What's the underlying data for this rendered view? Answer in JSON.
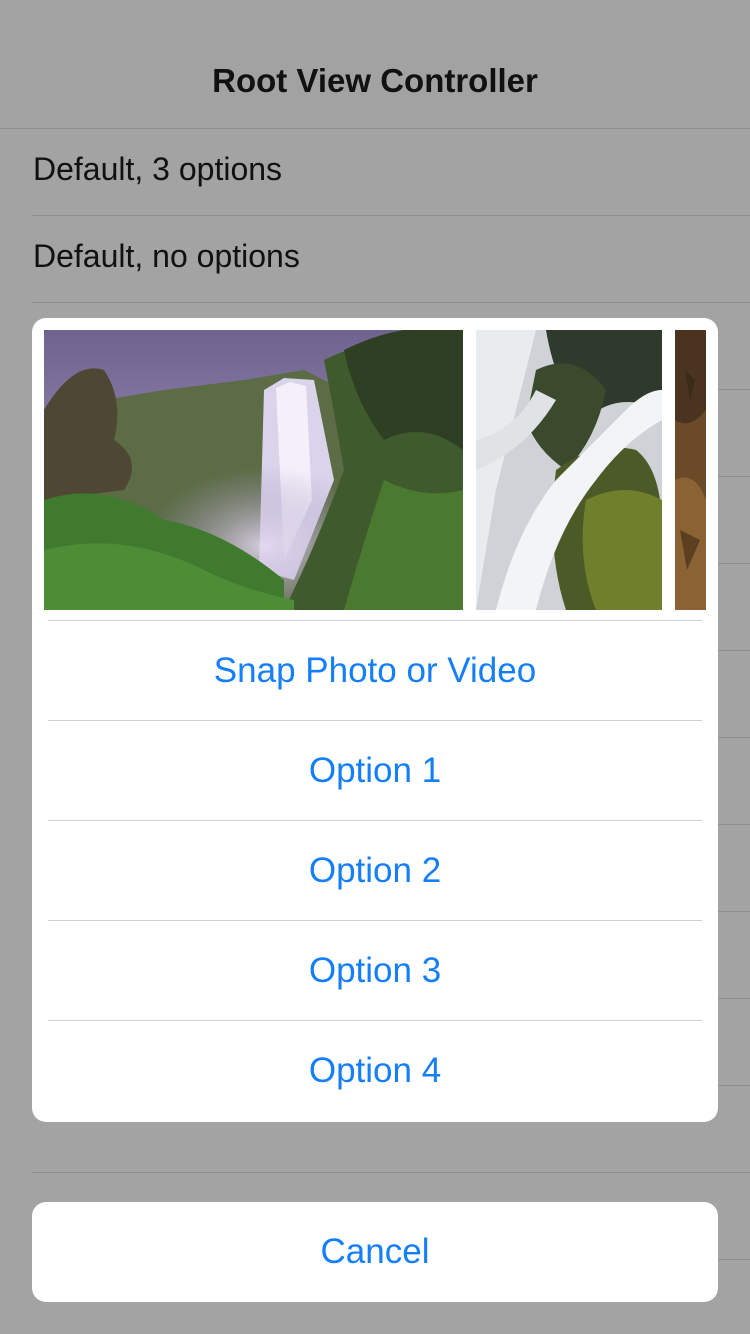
{
  "navbar": {
    "title": "Root View Controller"
  },
  "table": {
    "rows": [
      {
        "label": "Default, 3 options"
      },
      {
        "label": "Default, no options"
      },
      {
        "label": ""
      },
      {
        "label": ""
      },
      {
        "label": ""
      },
      {
        "label": ""
      },
      {
        "label": ""
      },
      {
        "label": ""
      },
      {
        "label": ""
      },
      {
        "label": ""
      },
      {
        "label": ""
      },
      {
        "label": ""
      },
      {
        "label": ""
      }
    ]
  },
  "action_sheet": {
    "photos": [
      {
        "description": "waterfall-landscape"
      },
      {
        "description": "waterfall-rocks-closeup"
      },
      {
        "description": "rock-texture-partial"
      }
    ],
    "options": [
      {
        "label": "Snap Photo or Video"
      },
      {
        "label": "Option 1"
      },
      {
        "label": "Option 2"
      },
      {
        "label": "Option 3"
      },
      {
        "label": "Option 4"
      }
    ],
    "cancel_label": "Cancel"
  },
  "colors": {
    "tint": "#147efb",
    "dimmed_background": "#a3a3a3",
    "sheet_background": "#ffffff"
  }
}
